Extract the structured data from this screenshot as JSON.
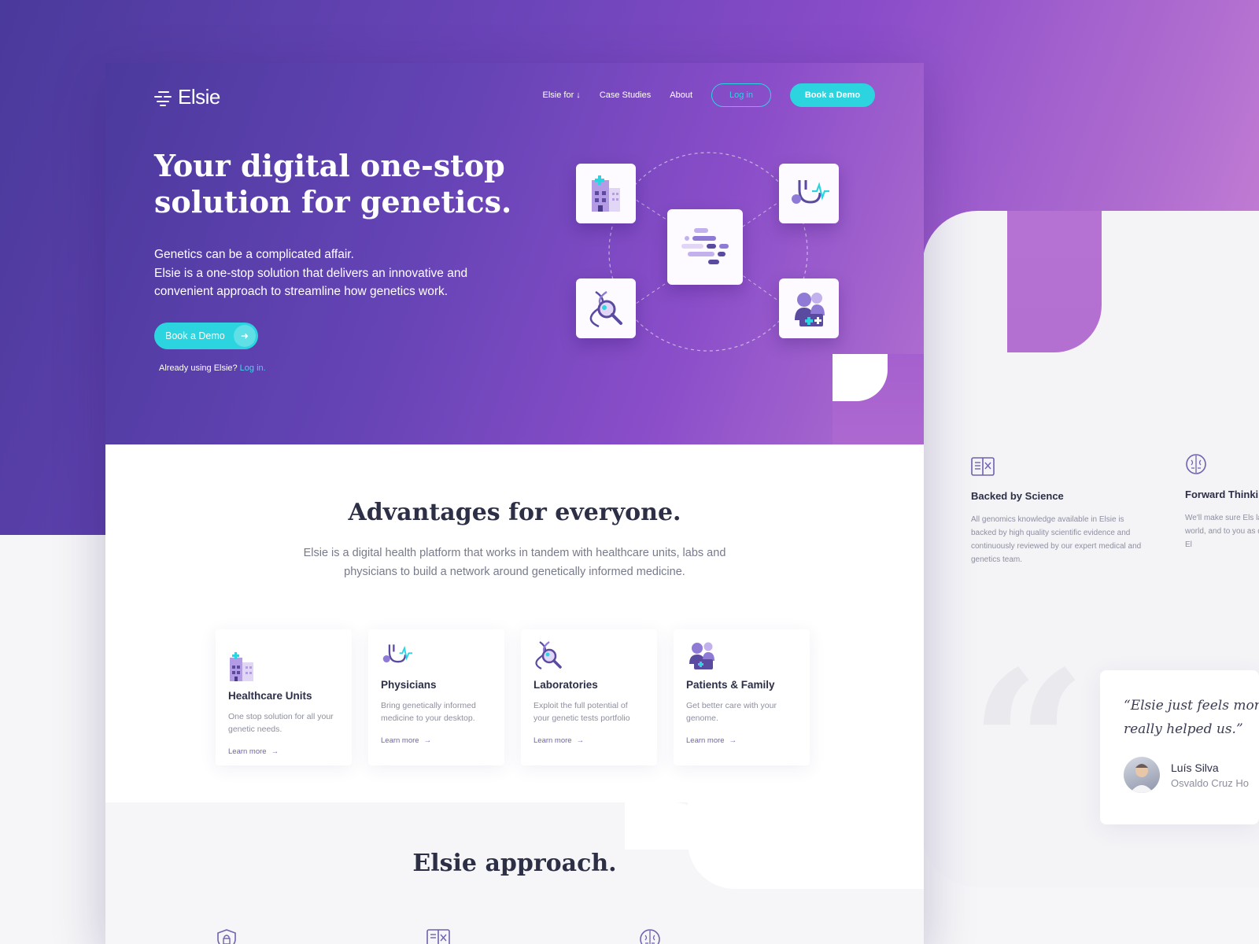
{
  "brand": {
    "name": "Elsie",
    "accent": "#2cd4df",
    "purple": "#6a44b8"
  },
  "nav": {
    "items": [
      {
        "label": "Elsie for ↓"
      },
      {
        "label": "Case Studies"
      },
      {
        "label": "About"
      }
    ],
    "login_label": "Log in",
    "demo_label": "Book a Demo"
  },
  "hero": {
    "title": "Your digital one-stop solution for genetics.",
    "desc_line1": "Genetics can be a complicated affair.",
    "desc_line2": "Elsie is a one-stop solution that delivers an innovative and convenient approach to streamline how genetics work.",
    "cta_label": "Book a Demo",
    "already_text": "Already using Elsie?",
    "already_link": "Log in."
  },
  "advantages": {
    "title": "Advantages for everyone.",
    "desc": "Elsie is a digital health platform that works in tandem with healthcare units, labs and physicians to build a network around genetically informed medicine.",
    "cards": [
      {
        "icon": "hospital-icon",
        "title": "Healthcare Units",
        "desc": "One stop solution for all your genetic needs.",
        "link": "Learn more"
      },
      {
        "icon": "stethoscope-icon",
        "title": "Physicians",
        "desc": "Bring genetically informed medicine to your desktop.",
        "link": "Learn more"
      },
      {
        "icon": "dna-search-icon",
        "title": "Laboratories",
        "desc": "Exploit the full potential of your genetic tests portfolio",
        "link": "Learn more"
      },
      {
        "icon": "family-icon",
        "title": "Patients & Family",
        "desc": "Get better care with your genome.",
        "link": "Learn more"
      }
    ]
  },
  "approach": {
    "title": "Elsie approach."
  },
  "side": {
    "features": [
      {
        "icon": "book-icon",
        "title": "Backed by Science",
        "desc": "All genomics knowledge available in Elsie is backed by high quality scientific evidence and continuously reviewed by our expert medical and genetics team."
      },
      {
        "icon": "brain-icon",
        "title": "Forward Thinki",
        "desc": "We'll make sure Els latest groundbreaki genetics world, and to you as quickly as cutting edge with El"
      }
    ],
    "testimonial": {
      "quote": "“Elsie just feels more really helped us.”",
      "name": "Luís Silva",
      "org": "Osvaldo Cruz Ho"
    }
  }
}
